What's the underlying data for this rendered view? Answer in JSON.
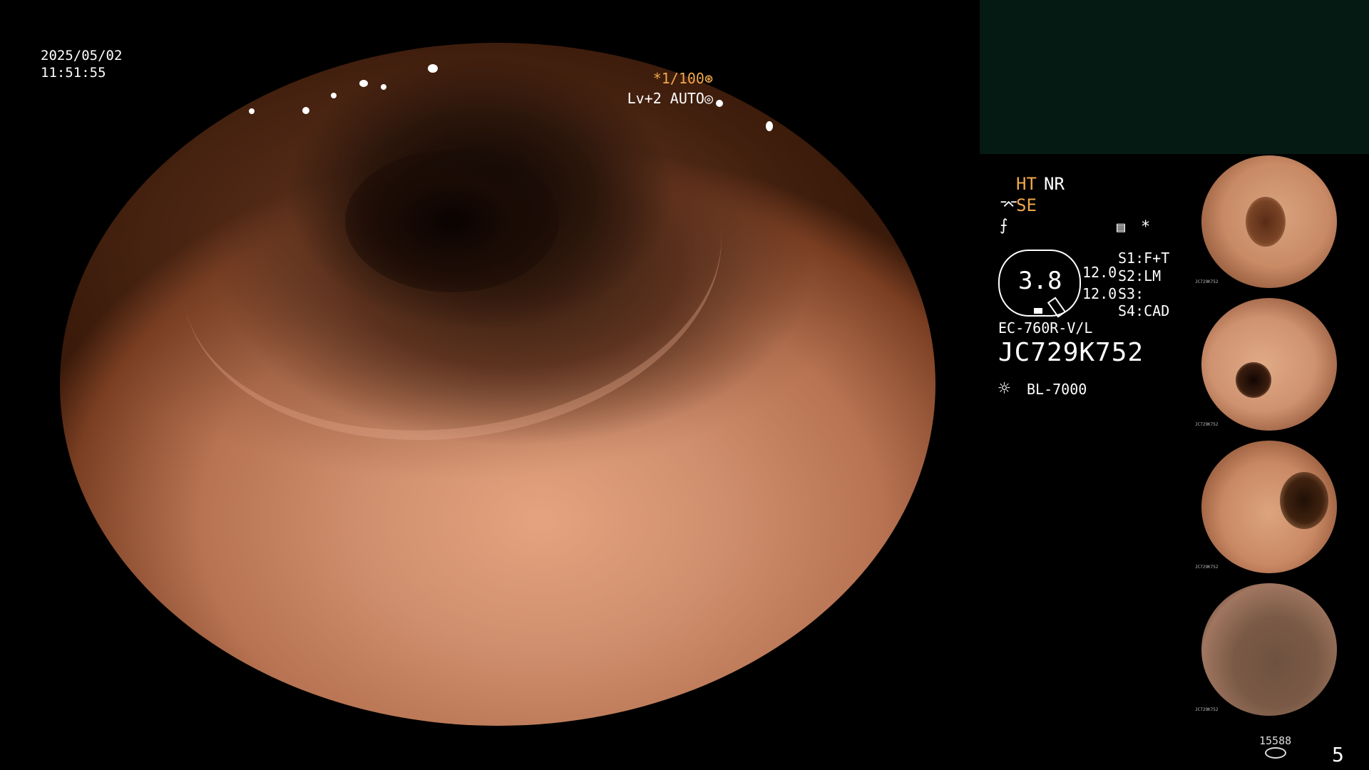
{
  "overlay": {
    "date": "2025/05/02",
    "time": "11:51:55",
    "shutter": "*1/100⊛",
    "level": "Lv+2 AUTO◎"
  },
  "info": {
    "ht": "HT",
    "nr": "NR",
    "se": "SE",
    "se_icon": "⌤",
    "f_icon": "⨍",
    "list_icon": "▤",
    "star": "*",
    "badge_value": "3.8",
    "val1": "12.0",
    "val2": "12.0",
    "s1": "S1:F+T",
    "s2": "S2:LM",
    "s3": "S3:",
    "s4": "S4:CAD",
    "model": "EC-760R-V/L",
    "serial": "JC729K752",
    "light_icon": "☼",
    "light": "BL-7000"
  },
  "thumbnails": [
    {
      "label": "thumbnail-1",
      "caption": "JC729K752"
    },
    {
      "label": "thumbnail-2",
      "caption": "JC729K752"
    },
    {
      "label": "thumbnail-3",
      "caption": "JC729K752"
    },
    {
      "label": "thumbnail-4",
      "caption": "JC729K752"
    }
  ],
  "footer": {
    "count": "15588",
    "page": "5"
  },
  "colors": {
    "accent": "#f0a84a",
    "panel": "#061a14",
    "tissue": "#cf8e6d"
  }
}
